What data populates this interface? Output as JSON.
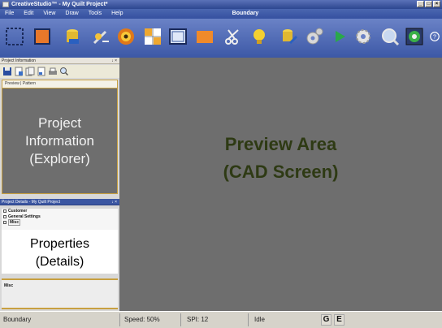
{
  "window": {
    "title": "CreativeStudio™ - My Quilt Project*"
  },
  "menu": {
    "items": [
      "File",
      "Edit",
      "View",
      "Draw",
      "Tools",
      "Help"
    ],
    "context": "Boundary"
  },
  "toolbar": {
    "tools": [
      "boundary-icon",
      "block-icon",
      "bucket-icon",
      "sew-icon",
      "spiral-icon",
      "grid-icon",
      "layout-icon",
      "fill-icon",
      "scissors-icon",
      "lightbulb-icon",
      "paint-icon",
      "gears-icon",
      "play-icon",
      "settings-icon",
      "zoom-icon",
      "globe-icon",
      "help-icon"
    ]
  },
  "project_panel": {
    "header": "Project Information",
    "header_controls": "↓ ×",
    "tabs": "Preview | Pattern",
    "label_lines": [
      "Project",
      "Information",
      "(Explorer)"
    ]
  },
  "details_panel": {
    "header": "Project Details - My Quilt Project",
    "header_controls": "↓ ×",
    "rows": [
      "Customer",
      "General Settings",
      "Misc"
    ],
    "label_lines": [
      "Properties",
      "(Details)"
    ],
    "misc_caption": "Misc"
  },
  "preview": {
    "label_lines": [
      "Preview Area",
      "(CAD Screen)"
    ]
  },
  "status": {
    "mode": "Boundary",
    "speed": "Speed: 50%",
    "spi": "SPI: 12",
    "state": "Idle",
    "g": "G",
    "e": "E"
  }
}
